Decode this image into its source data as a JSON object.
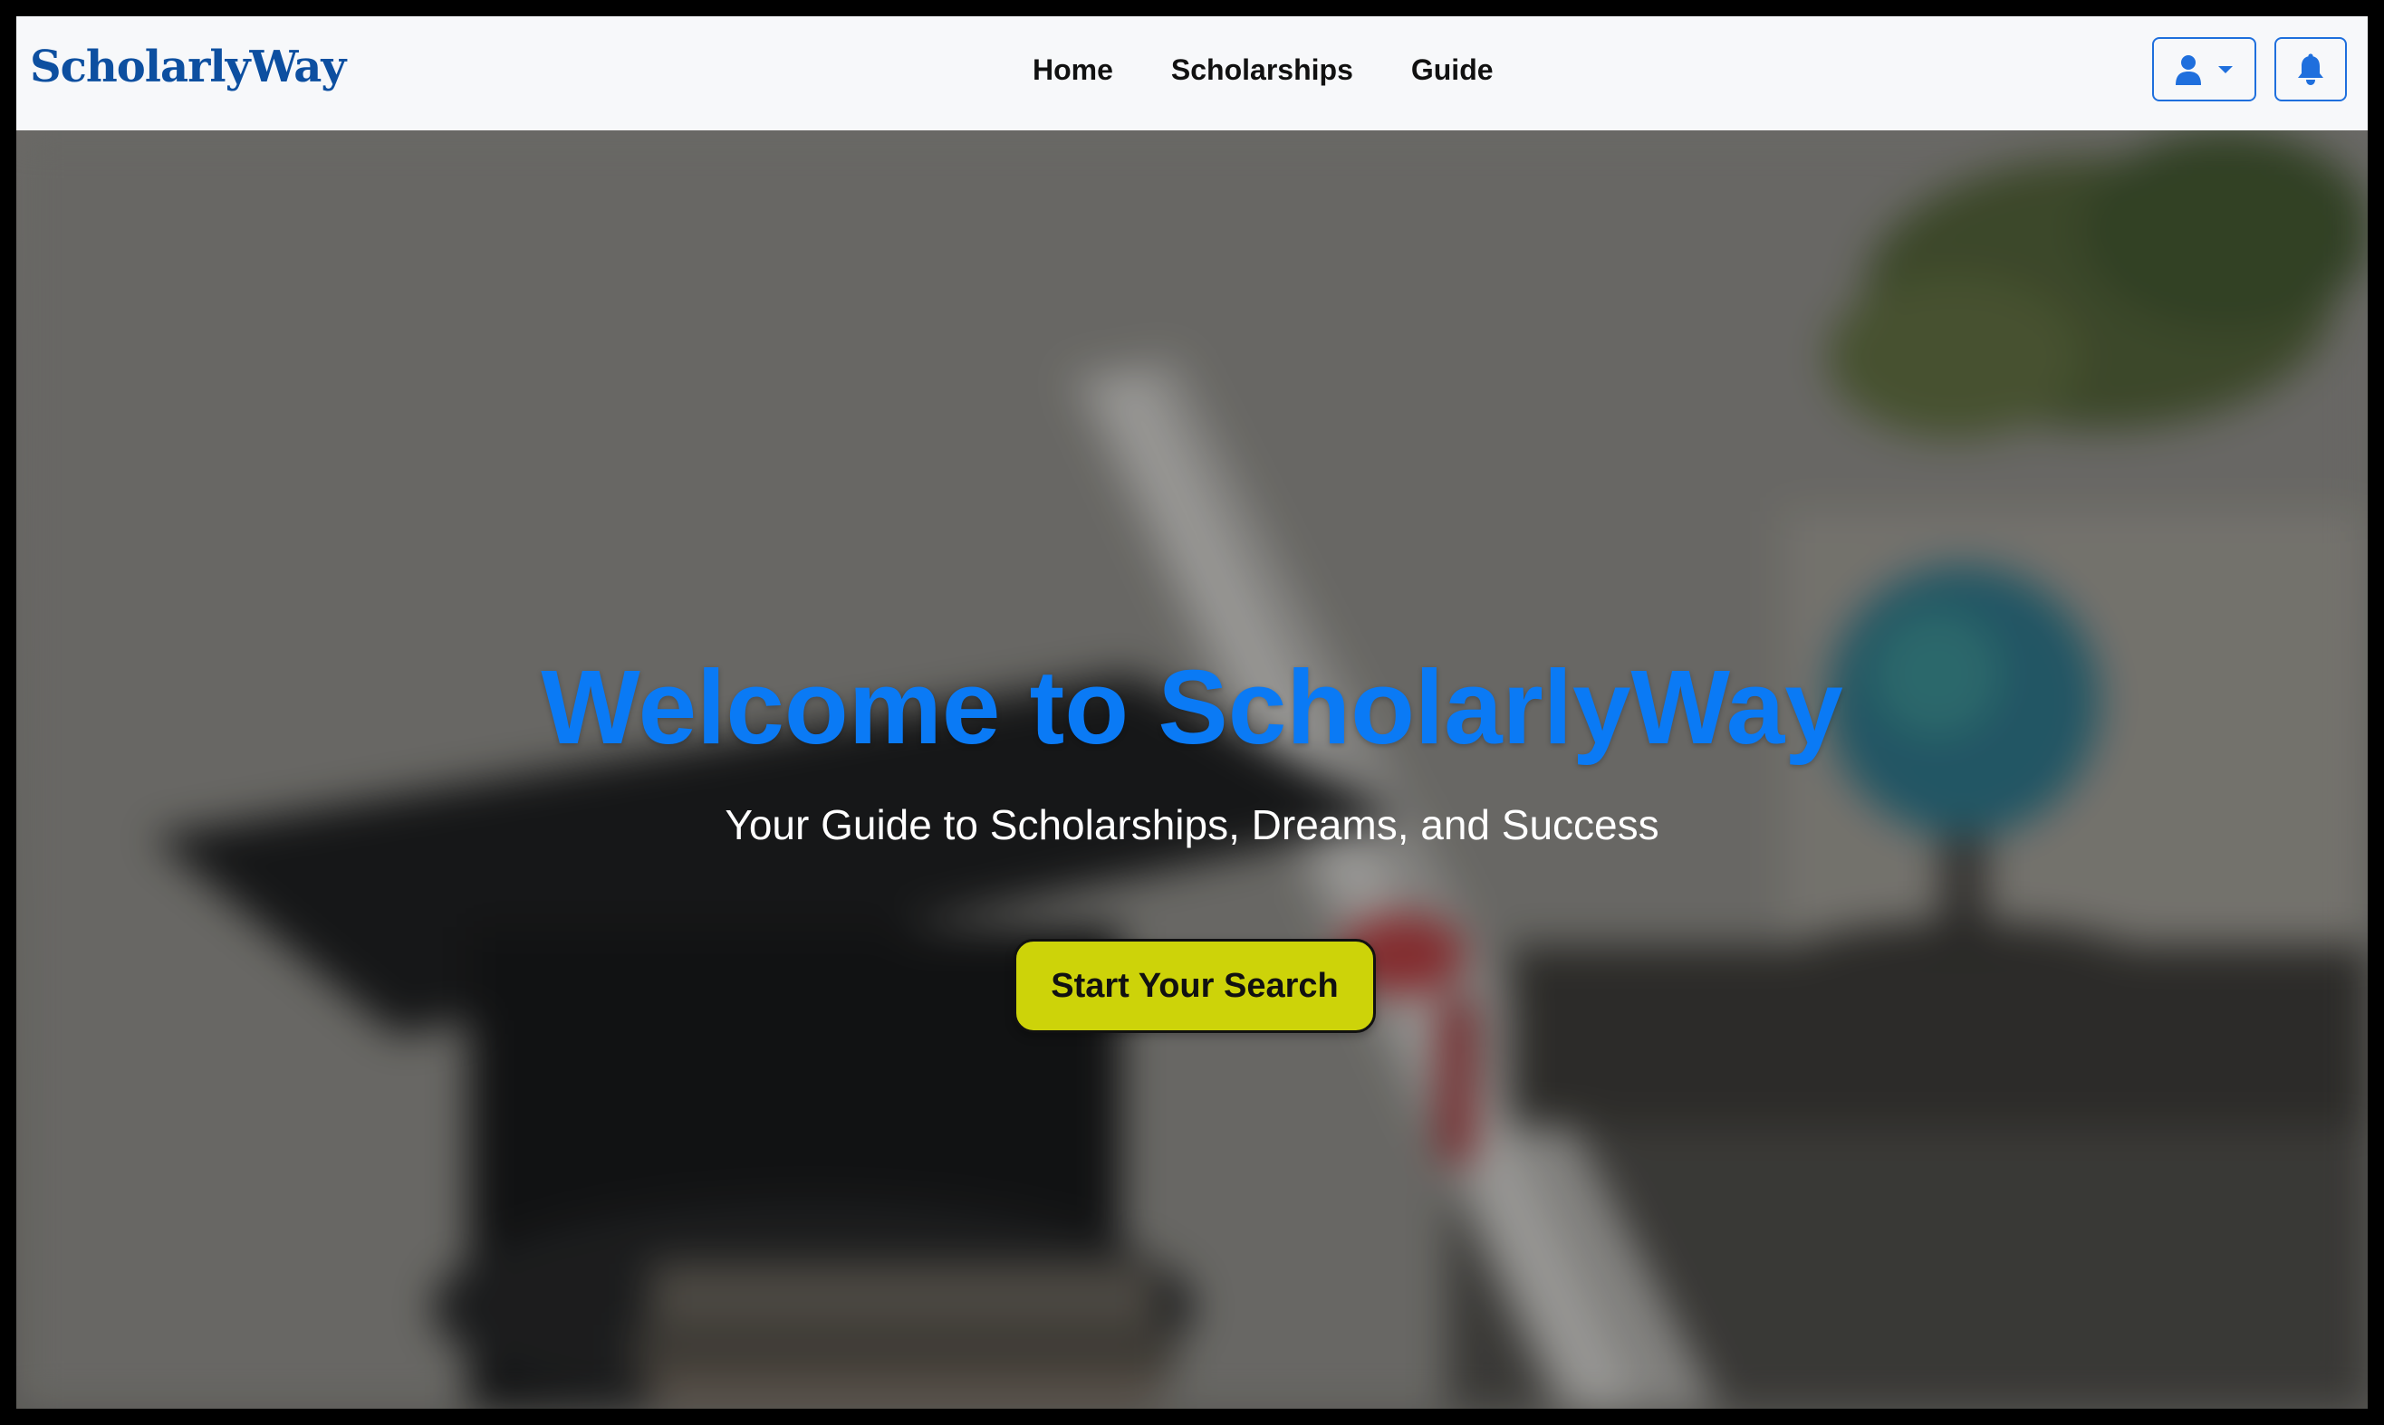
{
  "brand": {
    "name": "ScholarlyWay",
    "color": "#0d4fa0"
  },
  "nav": {
    "links": [
      {
        "label": "Home"
      },
      {
        "label": "Scholarships"
      },
      {
        "label": "Guide"
      }
    ],
    "user_menu_icon": "user-icon",
    "user_menu_caret_icon": "caret-down-icon",
    "notifications_icon": "bell-icon",
    "button_accent": "#1f6fdd"
  },
  "hero": {
    "title": "Welcome to ScholarlyWay",
    "title_color": "#0a7af5",
    "subtitle": "Your Guide to Scholarships, Dreams, and Success",
    "cta_label": "Start Your Search",
    "cta_color": "#cdd309",
    "background_image": "blurred photo of a graduation cap, rolled diploma with red ribbon, globe and plant"
  }
}
